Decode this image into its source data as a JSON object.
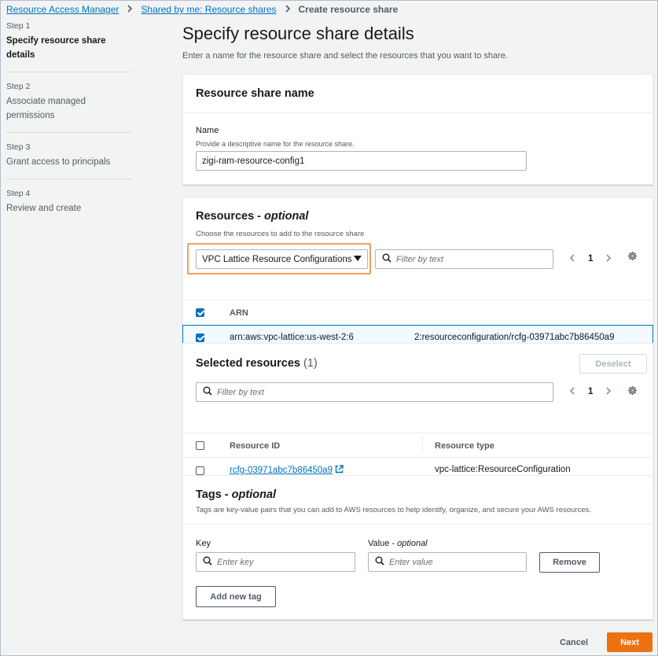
{
  "breadcrumb": {
    "items": [
      "Resource Access Manager",
      "Shared by me: Resource shares"
    ],
    "current": "Create resource share"
  },
  "steps": [
    {
      "num": "Step 1",
      "label": "Specify resource share details"
    },
    {
      "num": "Step 2",
      "label": "Associate managed permissions"
    },
    {
      "num": "Step 3",
      "label": "Grant access to principals"
    },
    {
      "num": "Step 4",
      "label": "Review and create"
    }
  ],
  "page": {
    "title": "Specify resource share details",
    "description": "Enter a name for the resource share and select the resources that you want to share."
  },
  "name_panel": {
    "title": "Resource share name",
    "field_label": "Name",
    "field_desc": "Provide a descriptive name for the resource share.",
    "value": "zigi-ram-resource-config1"
  },
  "resources_panel": {
    "title": "Resources - ",
    "title_optional": "optional",
    "subtitle": "Choose the resources to add to the resource share",
    "dropdown_value": "VPC Lattice Resource Configurations",
    "filter_placeholder": "Filter by text",
    "page_num": "1",
    "column_arn": "ARN",
    "row_arn_a": "arn:aws:vpc-lattice:us-west-2:6",
    "row_arn_b": "2:resourceconfiguration/rcfg-03971abc7b86450a9"
  },
  "selected_panel": {
    "title": "Selected resources",
    "count": "(1)",
    "deselect_label": "Deselect",
    "filter_placeholder": "Filter by text",
    "page_num": "1",
    "col_resource_id": "Resource ID",
    "col_resource_type": "Resource type",
    "row_id": "rcfg-03971abc7b86450a9",
    "row_type": "vpc-lattice:ResourceConfiguration"
  },
  "tags_panel": {
    "title": "Tags - ",
    "title_optional": "optional",
    "subtitle": "Tags are key-value pairs that you can add to AWS resources to help identify, organize, and secure your AWS resources.",
    "key_label": "Key",
    "value_label": "Value - ",
    "value_optional": "optional",
    "key_placeholder": "Enter key",
    "value_placeholder": "Enter value",
    "remove_label": "Remove",
    "add_tag_label": "Add new tag"
  },
  "footer": {
    "cancel_label": "Cancel",
    "next_label": "Next"
  },
  "colors": {
    "link": "#0073bb",
    "primary": "#ec7211",
    "highlight": "#f0a060",
    "selected_row_border": "#0073bb"
  },
  "icons": [
    "chevron-right-icon",
    "caret-down-icon",
    "search-icon",
    "chevron-left-icon",
    "gear-icon",
    "external-link-icon"
  ]
}
